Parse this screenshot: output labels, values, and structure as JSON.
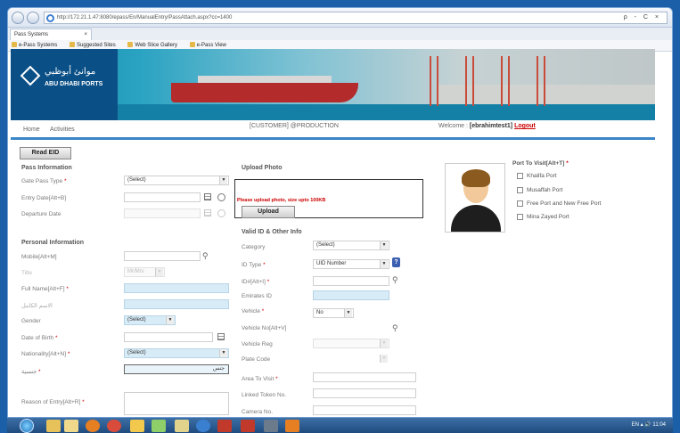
{
  "browser": {
    "url": "http://172.21.1.47:8080/epass/En/ManualEntry/PassAttach.aspx?cc=1400",
    "tab_title": "Pass Systems",
    "tab_close": "×",
    "address_tools": "ρ - C ×",
    "favorites": [
      "e-Pass Systems",
      "Suggested Sites",
      "Web Slice Gallery",
      "e-Pass View"
    ]
  },
  "logo": {
    "arabic": "موانئ أبوظبي",
    "english": "ABU DHABI PORTS"
  },
  "nav": {
    "home": "Home",
    "activities": "Activities",
    "customer": "[CUSTOMER] @PRODUCTION",
    "welcome_prefix": "Welcome :",
    "user": "[ebrahimtest1]",
    "logout": "Logout"
  },
  "read_eid": "Read EID",
  "pass_info": {
    "heading": "Pass Information",
    "gate_pass_type": "Gate Pass Type",
    "gate_pass_value": "(Select)",
    "entry_date": "Entry Date[Alt+B]",
    "departure_date": "Departure Date"
  },
  "personal": {
    "heading": "Personal Information",
    "mobile": "Mobile[Alt+M]",
    "title": "Title",
    "title_value": "Mr/Mrs",
    "full_name": "Full Name[Alt+F]",
    "arabic_name": "الاسم الكامل",
    "gender": "Gender",
    "gender_value": "(Select)",
    "dob": "Date of Birth",
    "nationality": "Nationality[Alt+N]",
    "nationality_value": "(Select)",
    "extra_label": "جنسية",
    "extra_value": "جنس",
    "reason": "Reason of Entry[Alt+R]"
  },
  "upload": {
    "heading": "Upload Photo",
    "message": "Please upload photo, size upto 100KB",
    "button": "Upload"
  },
  "valid_id": {
    "heading": "Valid ID & Other Info",
    "category": "Category",
    "category_value": "(Select)",
    "id_type": "ID Type",
    "id_type_value": "UID Number",
    "help": "?",
    "id_no": "ID#[Alt+I]",
    "emirates_id": "Emirates ID",
    "vehicle": "Vehicle",
    "vehicle_value": "No",
    "vehicle_no": "Vehicle No[Alt+V]",
    "vehicle_reg": "Vehicle Reg",
    "plate_code": "Plate Code",
    "area_to_visit": "Area To Visit",
    "linked_token": "Linked Token No.",
    "camera_no": "Camera No."
  },
  "port_visit": {
    "heading": "Port To Visit[Alt+T]",
    "ports": [
      "Khalifa Port",
      "Musaffah Port",
      "Free Port and New Free Port",
      "Mina Zayed Port"
    ]
  },
  "required_mark": "*",
  "taskbar": {
    "tray": "EN ▴ 🔊 11:04"
  }
}
